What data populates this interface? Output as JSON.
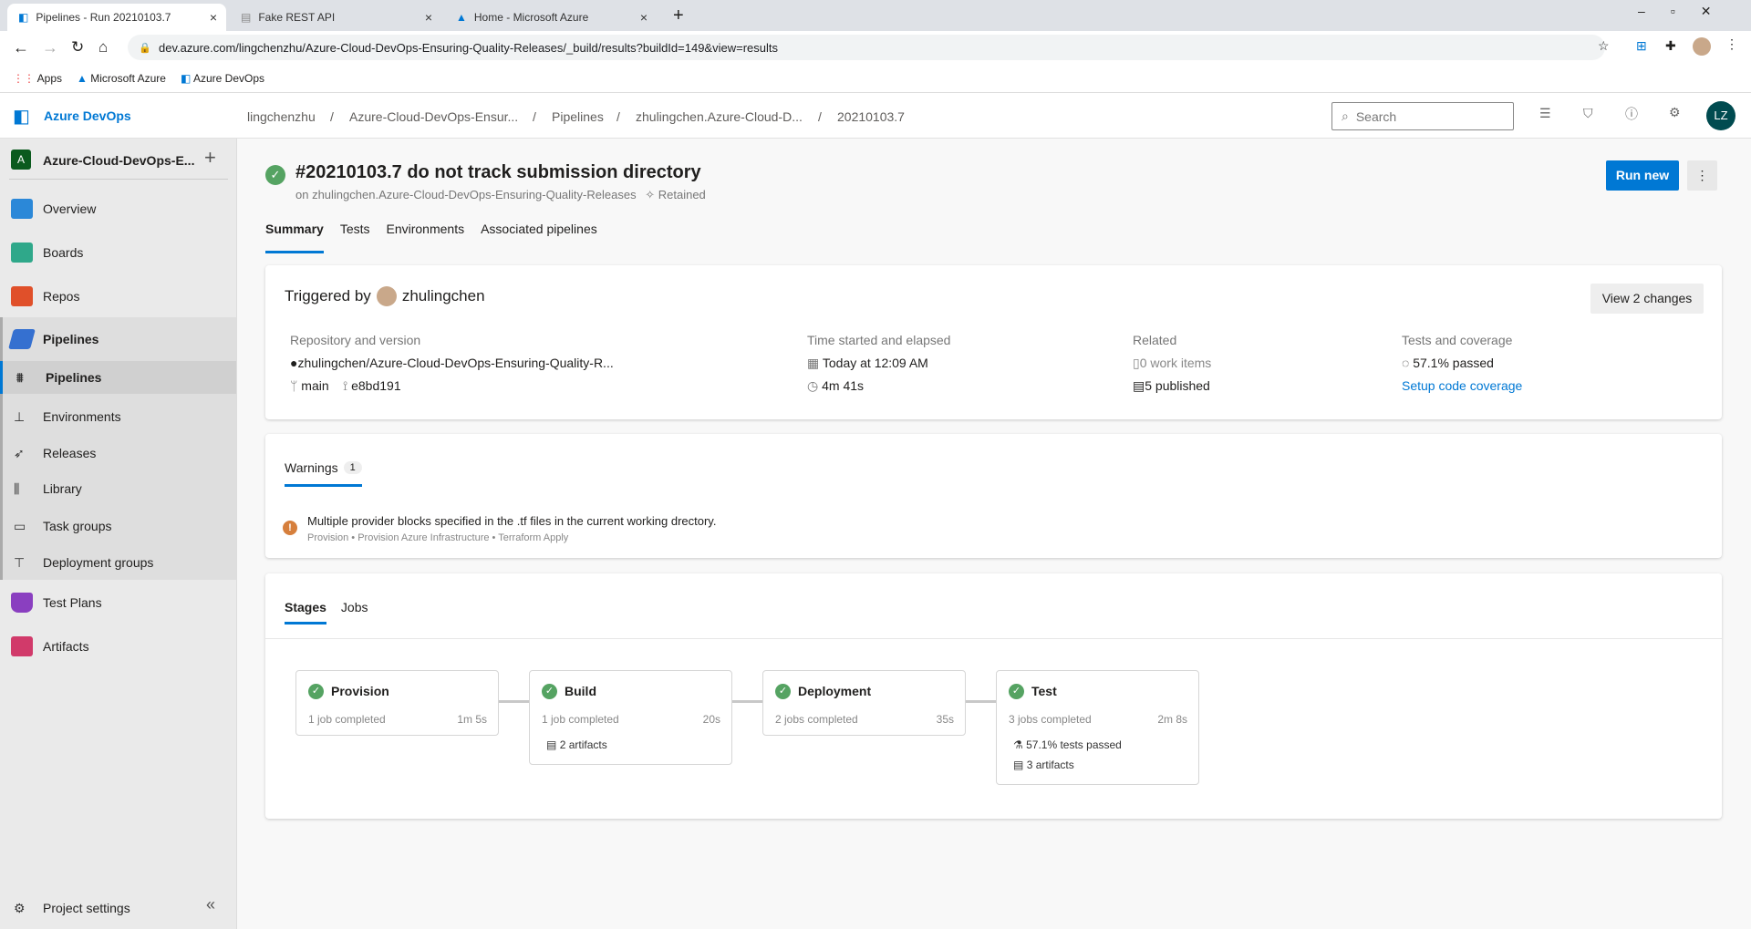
{
  "browser": {
    "tabs": [
      {
        "title": "Pipelines - Run 20210103.7"
      },
      {
        "title": "Fake REST API"
      },
      {
        "title": "Home - Microsoft Azure"
      }
    ],
    "url": "dev.azure.com/lingchenzhu/Azure-Cloud-DevOps-Ensuring-Quality-Releases/_build/results?buildId=149&view=results",
    "bookmarks": [
      "Apps",
      "Microsoft Azure",
      "Azure DevOps"
    ]
  },
  "header": {
    "brand": "Azure DevOps",
    "breadcrumbs": [
      "lingchenzhu",
      "Azure-Cloud-DevOps-Ensur...",
      "Pipelines",
      "zhulingchen.Azure-Cloud-D...",
      "20210103.7"
    ],
    "search_placeholder": "Search",
    "avatar": "LZ"
  },
  "sidebar": {
    "project_initial": "A",
    "project": "Azure-Cloud-DevOps-E...",
    "items": [
      {
        "label": "Overview"
      },
      {
        "label": "Boards"
      },
      {
        "label": "Repos"
      },
      {
        "label": "Pipelines"
      },
      {
        "label": "Pipelines"
      },
      {
        "label": "Environments"
      },
      {
        "label": "Releases"
      },
      {
        "label": "Library"
      },
      {
        "label": "Task groups"
      },
      {
        "label": "Deployment groups"
      },
      {
        "label": "Test Plans"
      },
      {
        "label": "Artifacts"
      }
    ],
    "settings": "Project settings"
  },
  "run": {
    "title": "#20210103.7 do not track submission directory",
    "subtitle": "on zhulingchen.Azure-Cloud-DevOps-Ensuring-Quality-Releases",
    "retained": "Retained",
    "run_new": "Run new",
    "tabs": [
      "Summary",
      "Tests",
      "Environments",
      "Associated pipelines"
    ]
  },
  "summary": {
    "triggered_by": "Triggered by",
    "user": "zhulingchen",
    "view_changes": "View 2 changes",
    "repo_label": "Repository and version",
    "repo": "zhulingchen/Azure-Cloud-DevOps-Ensuring-Quality-R...",
    "branch": "main",
    "commit": "e8bd191",
    "time_label": "Time started and elapsed",
    "started": "Today at 12:09 AM",
    "elapsed": "4m 41s",
    "related_label": "Related",
    "work_items": "0 work items",
    "published": "5 published",
    "tests_label": "Tests and coverage",
    "passed": "57.1% passed",
    "coverage_link": "Setup code coverage"
  },
  "warnings": {
    "tab": "Warnings",
    "count": "1",
    "message": "Multiple provider blocks specified in the .tf files in the current working drectory.",
    "path": "Provision • Provision Azure Infrastructure • Terraform Apply"
  },
  "stages": {
    "tabs": [
      "Stages",
      "Jobs"
    ],
    "items": [
      {
        "name": "Provision",
        "jobs": "1 job completed",
        "duration": "1m 5s"
      },
      {
        "name": "Build",
        "jobs": "1 job completed",
        "duration": "20s",
        "artifacts": "2 artifacts"
      },
      {
        "name": "Deployment",
        "jobs": "2 jobs completed",
        "duration": "35s"
      },
      {
        "name": "Test",
        "jobs": "3 jobs completed",
        "duration": "2m 8s",
        "tests": "57.1% tests passed",
        "artifacts": "3 artifacts"
      }
    ]
  },
  "colors": {
    "accent": "#0078d4",
    "success": "#55a362",
    "warning": "#d67f3c"
  }
}
